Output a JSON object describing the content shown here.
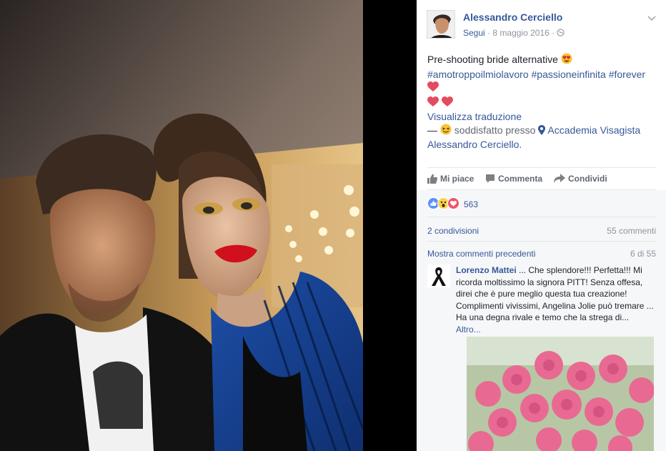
{
  "post": {
    "author": "Alessandro Cerciello",
    "follow_label": "Segui",
    "dot": "·",
    "date": "8 maggio 2016",
    "dot2": "·",
    "text": "Pre-shooting bride alternative",
    "hashtags": "#amotroppoilmiolavoro #passioneinfinita #forever",
    "translate_label": "Visualizza traduzione",
    "dash": "—",
    "feeling": "soddisfatto presso",
    "place": "Accademia Visagista Alessandro Cerciello."
  },
  "actions": {
    "like": "Mi piace",
    "comment": "Commenta",
    "share": "Condividi"
  },
  "stats": {
    "reactions_count": "563",
    "shares": "2 condivisioni",
    "comments": "55 commenti",
    "previous_comments": "Mostra commenti precedenti",
    "paging": "6 di 55"
  },
  "comment": {
    "author": "Lorenzo Mattei",
    "text": " ... Che splendore!!! Perfetta!!! Mi ricorda moltissimo la signora PITT! Senza offesa, direi che è pure meglio questa tua creazione! Complimenti vivissimi, Angelina Jolie può tremare ... Ha una degna rivale e temo che la strega di...",
    "more": "Altro..."
  },
  "colors": {
    "link": "#365899",
    "muted": "#90949c",
    "like_blue": "#5890ff",
    "love_red": "#f25268",
    "wow_yellow": "#fcd04d"
  },
  "icons": [
    "chevron-down-icon",
    "globe-icon",
    "heart-eyes-emoji",
    "heart-emoji",
    "satisfied-emoji",
    "location-pin-icon",
    "thumbs-up-icon",
    "comment-icon",
    "share-icon",
    "like-reaction-icon",
    "wow-reaction-icon",
    "love-reaction-icon",
    "black-ribbon-avatar"
  ]
}
